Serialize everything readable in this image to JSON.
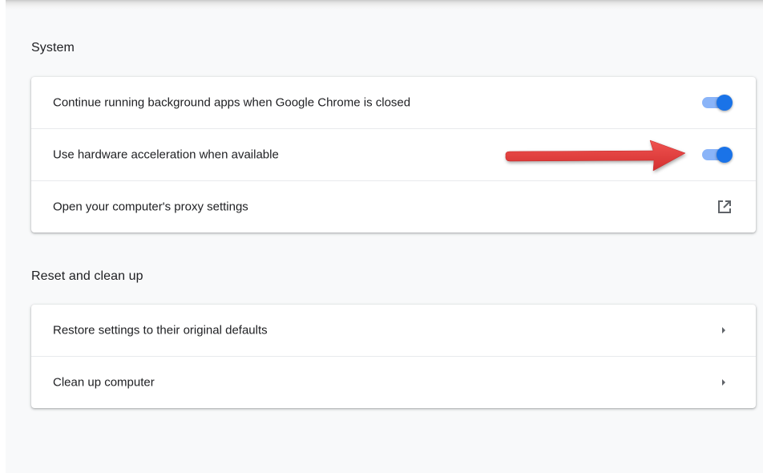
{
  "system": {
    "title": "System",
    "rows": [
      {
        "label": "Continue running background apps when Google Chrome is closed",
        "control": "toggle",
        "enabled": true
      },
      {
        "label": "Use hardware acceleration when available",
        "control": "toggle",
        "enabled": true
      },
      {
        "label": "Open your computer's proxy settings",
        "control": "external-link-icon"
      }
    ]
  },
  "reset": {
    "title": "Reset and clean up",
    "rows": [
      {
        "label": "Restore settings to their original defaults",
        "control": "chevron-right-icon"
      },
      {
        "label": "Clean up computer",
        "control": "chevron-right-icon"
      }
    ]
  },
  "colors": {
    "accent": "#1a73e8",
    "toggle_track": "#8ab4f8",
    "annotation_arrow": "#e53935",
    "page_background": "#f8f9fa"
  }
}
